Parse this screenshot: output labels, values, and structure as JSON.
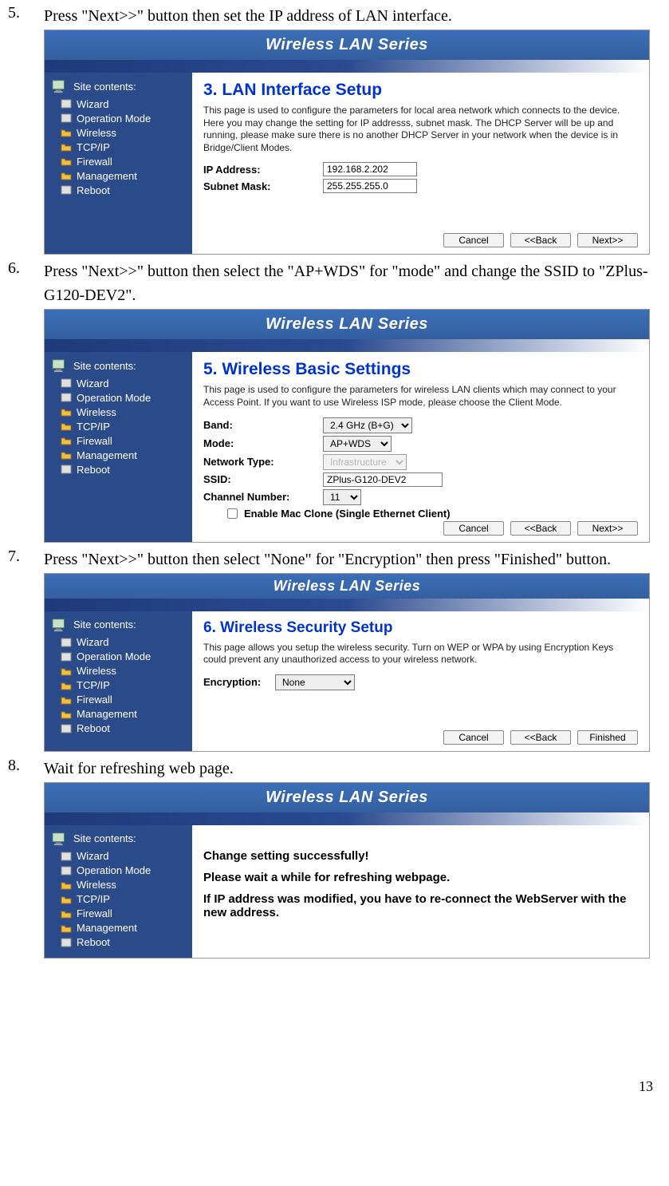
{
  "steps": {
    "s5": {
      "num": "5.",
      "text": "Press \"Next>>\" button then set the IP address of LAN interface."
    },
    "s6": {
      "num": "6.",
      "text": "Press \"Next>>\" button then select the \"AP+WDS\" for \"mode\" and change the SSID to \"ZPlus-G120-DEV2\"."
    },
    "s7": {
      "num": "7.",
      "text": "Press \"Next>>\" button then select \"None\" for \"Encryption\" then press \"Finished\" button."
    },
    "s8": {
      "num": "8.",
      "text": "Wait for refreshing web page."
    }
  },
  "title": "Wireless LAN Series",
  "sidebar": {
    "head": "Site contents:",
    "items": [
      "Wizard",
      "Operation Mode",
      "Wireless",
      "TCP/IP",
      "Firewall",
      "Management",
      "Reboot"
    ]
  },
  "p3": {
    "heading": "3.  LAN Interface Setup",
    "desc": "This page is used to configure the parameters for local area network which connects to the device. Here you may change the setting for IP addresss, subnet mask. The DHCP Server will be up and running, please make sure there is no another DHCP Server in your network when the device is in Bridge/Client Modes.",
    "ipLabel": "IP Address:",
    "ip": "192.168.2.202",
    "maskLabel": "Subnet Mask:",
    "mask": "255.255.255.0"
  },
  "p5": {
    "heading": "5.  Wireless Basic Settings",
    "desc": "This page is used to configure the parameters for wireless LAN clients which may connect to your Access Point. If you want to use Wireless ISP mode, please choose the Client Mode.",
    "bandLabel": "Band:",
    "band": "2.4 GHz (B+G)",
    "modeLabel": "Mode:",
    "mode": "AP+WDS",
    "ntLabel": "Network Type:",
    "nt": "Infrastructure",
    "ssidLabel": "SSID:",
    "ssid": "ZPlus-G120-DEV2",
    "chLabel": "Channel Number:",
    "ch": "11",
    "macClone": "Enable Mac Clone (Single Ethernet Client)"
  },
  "p6": {
    "heading": "6.  Wireless Security Setup",
    "desc": "This page allows you setup the wireless security. Turn on WEP or WPA by using Encryption Keys could prevent any unauthorized access to your wireless network.",
    "encLabel": "Encryption:",
    "enc": "None"
  },
  "p8": {
    "l1": "Change setting successfully!",
    "l2": "Please wait a while for refreshing webpage.",
    "l3": "If IP address was modified, you have to re-connect the WebServer with the new address."
  },
  "btn": {
    "cancel": "Cancel",
    "back": "<<Back",
    "next": "Next>>",
    "finished": "Finished"
  },
  "pagenum": "13"
}
